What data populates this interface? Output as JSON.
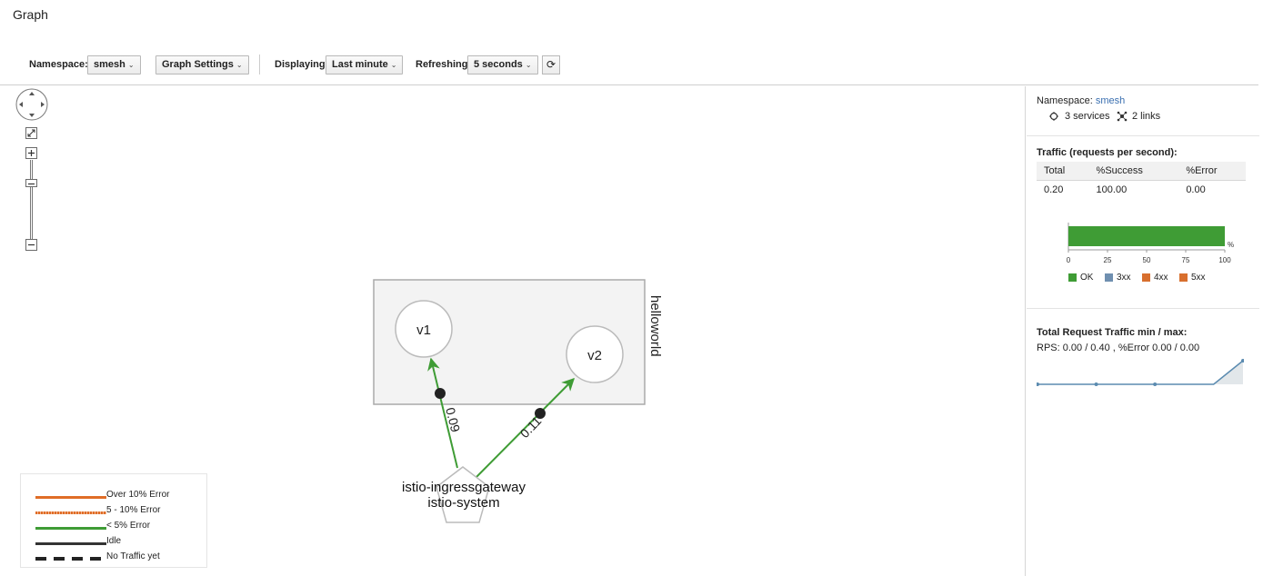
{
  "page": {
    "title": "Graph"
  },
  "toolbar": {
    "namespace_label": "Namespace:",
    "namespace_value": "smesh",
    "graph_settings_label": "Graph Settings",
    "displaying_label": "Displaying",
    "displaying_value": "Last minute",
    "refreshing_label": "Refreshing",
    "refreshing_value": "5 seconds",
    "caret": "⌄",
    "refresh_icon": "⟳"
  },
  "graph": {
    "group_label": "helloworld",
    "nodes": [
      {
        "id": "v1",
        "label": "v1"
      },
      {
        "id": "v2",
        "label": "v2"
      },
      {
        "id": "gateway",
        "label_line1": "istio-ingressgateway",
        "label_line2": "istio-system",
        "shape": "pentagon"
      }
    ],
    "edges": [
      {
        "from": "gateway",
        "to": "v1",
        "rate": "0.09",
        "color": "#3f9c35"
      },
      {
        "from": "gateway",
        "to": "v2",
        "rate": "0.11",
        "color": "#3f9c35"
      }
    ]
  },
  "legend": {
    "items": [
      {
        "label": "Over 10% Error",
        "color": "#e06d27",
        "style": "solid"
      },
      {
        "label": "5 - 10% Error",
        "color": "#e06d27",
        "style": "dotted"
      },
      {
        "label": "< 5% Error",
        "color": "#3f9c35",
        "style": "solid"
      },
      {
        "label": "Idle",
        "color": "#333333",
        "style": "solid"
      },
      {
        "label": "No Traffic yet",
        "color": "#222222",
        "style": "dashed"
      }
    ]
  },
  "side": {
    "namespace_label": "Namespace:",
    "namespace_value": "smesh",
    "services": "3 services",
    "links": "2 links",
    "traffic_title": "Traffic (requests per second):",
    "traffic_table": {
      "headers": [
        "Total",
        "%Success",
        "%Error"
      ],
      "row": [
        "0.20",
        "100.00",
        "0.00"
      ]
    },
    "success_chart": {
      "series": [
        {
          "name": "OK",
          "value": 100,
          "color": "#3f9c35"
        },
        {
          "name": "3xx",
          "value": 0,
          "color": "#6f8fb0"
        },
        {
          "name": "4xx",
          "value": 0,
          "color": "#d86f2e"
        },
        {
          "name": "5xx",
          "value": 0,
          "color": "#d86f2e"
        }
      ],
      "ticks": [
        "0",
        "25",
        "50",
        "75",
        "100"
      ],
      "unit": "%"
    },
    "rps_title": "Total Request Traffic min / max:",
    "rps_summary": "RPS: 0.00 / 0.40 , %Error 0.00 / 0.00",
    "sparkline": [
      0.0,
      0.0,
      0.0,
      0.0,
      0.0,
      0.0,
      0.0,
      0.4
    ]
  },
  "chart_data": [
    {
      "type": "bar",
      "categories": [
        "OK",
        "3xx",
        "4xx",
        "5xx"
      ],
      "values": [
        100,
        0,
        0,
        0
      ],
      "xlim": [
        0,
        100
      ],
      "ticks": [
        0,
        25,
        50,
        75,
        100
      ],
      "unit": "%"
    },
    {
      "type": "area",
      "y": [
        0.0,
        0.0,
        0.0,
        0.0,
        0.0,
        0.0,
        0.0,
        0.4
      ],
      "ylim": [
        0,
        0.4
      ]
    }
  ]
}
